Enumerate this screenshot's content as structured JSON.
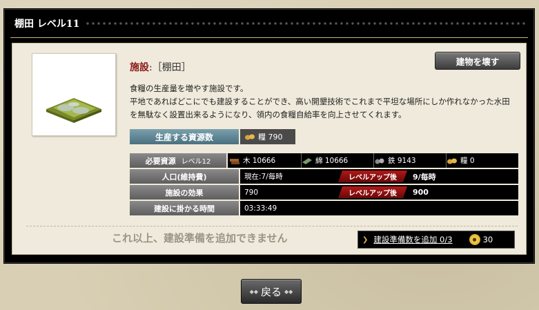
{
  "window": {
    "title": "棚田 レベル11"
  },
  "facility": {
    "label": "施設",
    "name": ":［棚田］",
    "desc1": "食糧の生産量を増やす施設です。",
    "desc2": "平地であればどこにでも建設することができ、高い開墾技術でこれまで平坦な場所にしか作れなかった水田を無駄なく設置出来るようになり、領内の食糧自給率を向上させてくれます。",
    "demolish_label": "建物を壊す",
    "image_icon": "terraced-rice-field"
  },
  "production": {
    "label": "生産する資源数",
    "value": "糧 790",
    "icon": "food-icon"
  },
  "requirements": {
    "label": "必要資源",
    "level": "レベル12",
    "wood": "木 10666",
    "cotton": "綿 10666",
    "iron": "鉄 9143",
    "food": "糧 0"
  },
  "population": {
    "label": "人口(維持費)",
    "current": "現在:7/毎時",
    "after_label": "レベルアップ後",
    "after": "9/毎時"
  },
  "effect": {
    "label": "施設の効果",
    "current": "790",
    "after_label": "レベルアップ後",
    "after": "900"
  },
  "build_time": {
    "label": "建設に掛かる時間",
    "value": "03:33:49"
  },
  "queue": {
    "message": "これ以上、建設準備を追加できません",
    "add_label": "建設準備数を追加 0/3",
    "cost": "30"
  },
  "back_label": "戻る",
  "colors": {
    "accent_red": "#8b1a1a",
    "teal": "#5a8896",
    "gold": "#d6b24a"
  }
}
